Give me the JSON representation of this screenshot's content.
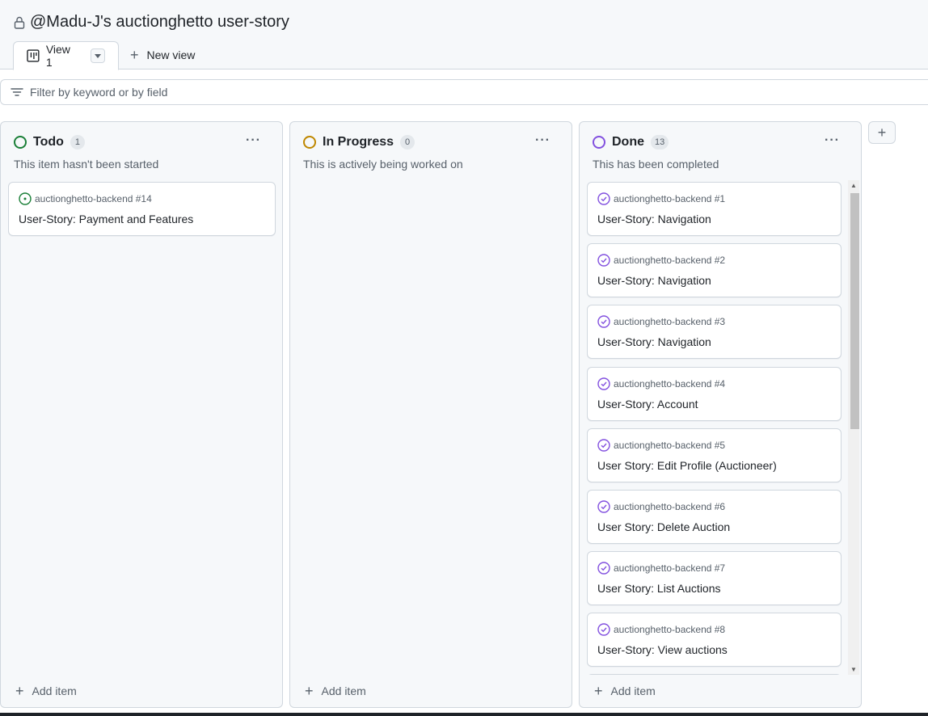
{
  "project": {
    "title": "@Madu-J's auctionghetto user-story"
  },
  "views": {
    "tabs": [
      {
        "label": "View 1"
      }
    ],
    "new_view_label": "New view"
  },
  "filter": {
    "placeholder": "Filter by keyword or by field"
  },
  "columns": [
    {
      "name": "Todo",
      "count": "1",
      "description": "This item hasn't been started",
      "color": "#1a7f37",
      "add_label": "Add item",
      "cards": [
        {
          "repo": "auctionghetto-backend #14",
          "title": "User-Story: Payment and Features",
          "state": "open"
        }
      ]
    },
    {
      "name": "In Progress",
      "count": "0",
      "description": "This is actively being worked on",
      "color": "#bf8700",
      "add_label": "Add item",
      "cards": []
    },
    {
      "name": "Done",
      "count": "13",
      "description": "This has been completed",
      "color": "#8250df",
      "add_label": "Add item",
      "cards": [
        {
          "repo": "auctionghetto-backend #1",
          "title": "User-Story: Navigation",
          "state": "closed"
        },
        {
          "repo": "auctionghetto-backend #2",
          "title": "User-Story: Navigation",
          "state": "closed"
        },
        {
          "repo": "auctionghetto-backend #3",
          "title": "User-Story: Navigation",
          "state": "closed"
        },
        {
          "repo": "auctionghetto-backend #4",
          "title": "User-Story: Account",
          "state": "closed"
        },
        {
          "repo": "auctionghetto-backend #5",
          "title": "User Story: Edit Profile (Auctioneer)",
          "state": "closed"
        },
        {
          "repo": "auctionghetto-backend #6",
          "title": "User Story: Delete Auction",
          "state": "closed"
        },
        {
          "repo": "auctionghetto-backend #7",
          "title": "User Story: List Auctions",
          "state": "closed"
        },
        {
          "repo": "auctionghetto-backend #8",
          "title": "User-Story: View auctions",
          "state": "closed"
        }
      ]
    }
  ],
  "icons": {
    "lock": "lock-icon",
    "board": "project-board-icon",
    "filter": "filter-icon",
    "open_issue": "issue-opened-icon",
    "closed_issue": "issue-closed-icon"
  }
}
